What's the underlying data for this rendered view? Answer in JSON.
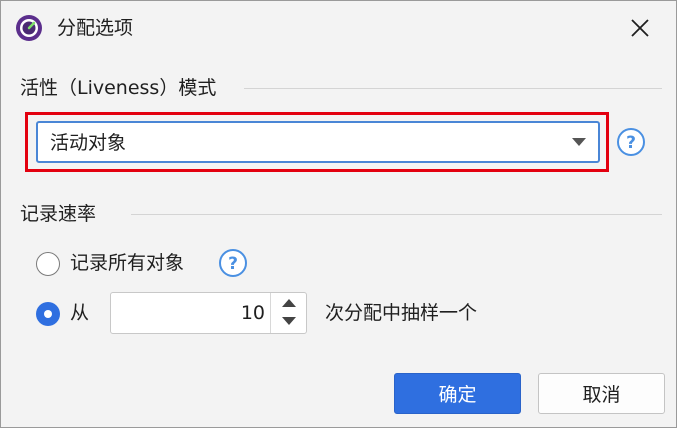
{
  "window": {
    "title": "分配选项",
    "icon": "app-gauge-icon",
    "close_icon": "close-icon"
  },
  "liveness": {
    "section_label": "活性（Liveness）模式",
    "selected_value": "活动对象"
  },
  "record_rate": {
    "section_label": "记录速率",
    "option_all_label": "记录所有对象",
    "option_all_selected": false,
    "option_sample_prefix": "从",
    "option_sample_selected": true,
    "sample_value": "10",
    "option_sample_suffix": "次分配中抽样一个"
  },
  "buttons": {
    "ok_label": "确定",
    "cancel_label": "取消"
  },
  "colors": {
    "accent": "#2f6fe0",
    "highlight_outline": "#e3000f",
    "help_icon": "#4a90e2"
  }
}
